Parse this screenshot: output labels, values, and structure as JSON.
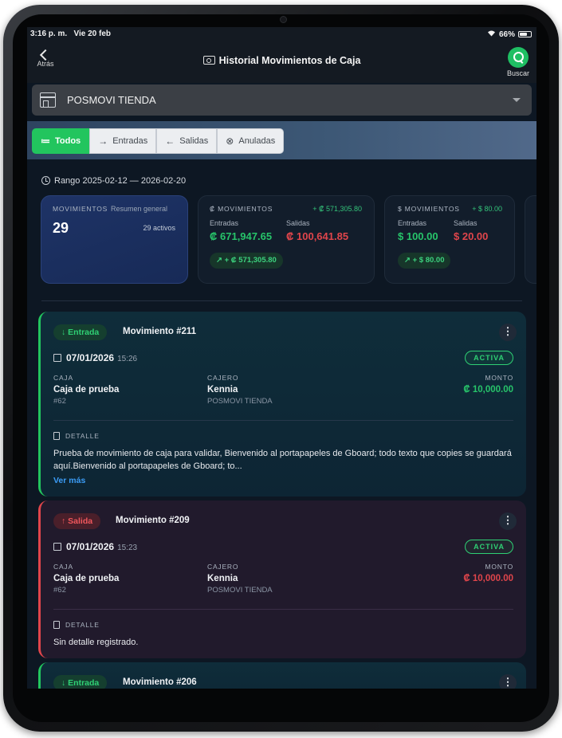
{
  "status_bar": {
    "time": "3:16 p. m.",
    "date": "Vie 20 feb",
    "wifi_icon": "wifi-icon",
    "battery": "66%"
  },
  "nav": {
    "back_label": "Atrás",
    "title": "Historial Movimientos de Caja",
    "search_label": "Buscar"
  },
  "store": {
    "selected": "POSMOVI TIENDA"
  },
  "filters": [
    {
      "label": "Todos",
      "icon": "≔",
      "active": true
    },
    {
      "label": "Entradas",
      "icon": "→"
    },
    {
      "label": "Salidas",
      "icon": "←"
    },
    {
      "label": "Anuladas",
      "icon": "⊗"
    }
  ],
  "range": "Rango 2025-02-12 — 2026-02-20",
  "summary": {
    "movimientos": {
      "label": "MOVIMIENTOS",
      "sub": "Resumen general",
      "count": "29",
      "active": "29 activos"
    },
    "colones": {
      "label": "₡ MOVIMIENTOS",
      "net": "+ ₡ 571,305.80",
      "in_label": "Entradas",
      "out_label": "Salidas",
      "in_value": "₡ 671,947.65",
      "out_value": "₡ 100,641.85",
      "pill": "↗ + ₡ 571,305.80"
    },
    "dolares": {
      "label": "$ MOVIMIENTOS",
      "net": "+ $ 80.00",
      "in_label": "Entradas",
      "out_label": "Salidas",
      "in_value": "$ 100.00",
      "out_value": "$ 20.00",
      "pill": "↗ + $ 80.00"
    }
  },
  "labels": {
    "caja": "CAJA",
    "cajero": "CAJERO",
    "monto": "MONTO",
    "detalle": "DETALLE",
    "ver_mas": "Ver más"
  },
  "movements": [
    {
      "type_label": "↓ Entrada",
      "title": "Movimiento #211",
      "date": "07/01/2026",
      "time": "15:26",
      "status": "ACTIVA",
      "caja": "Caja de prueba",
      "caja_id": "#62",
      "cajero": "Kennia",
      "tienda": "POSMOVI TIENDA",
      "monto": "₡ 10,000.00",
      "detalle": "Prueba de movimiento de caja para validar, Bienvenido al portapapeles de Gboard; todo texto que copies se guardará aquí.Bienvenido al portapapeles de Gboard; to..."
    },
    {
      "type_label": "↑ Salida",
      "title": "Movimiento #209",
      "date": "07/01/2026",
      "time": "15:23",
      "status": "ACTIVA",
      "caja": "Caja de prueba",
      "caja_id": "#62",
      "cajero": "Kennia",
      "tienda": "POSMOVI TIENDA",
      "monto": "₡ 10,000.00",
      "detalle": "Sin detalle registrado."
    },
    {
      "type_label": "↓ Entrada",
      "title": "Movimiento #206"
    }
  ],
  "colors": {
    "accent_green": "#22c55e",
    "danger_red": "#e0454b",
    "link_blue": "#3b9cf5"
  }
}
